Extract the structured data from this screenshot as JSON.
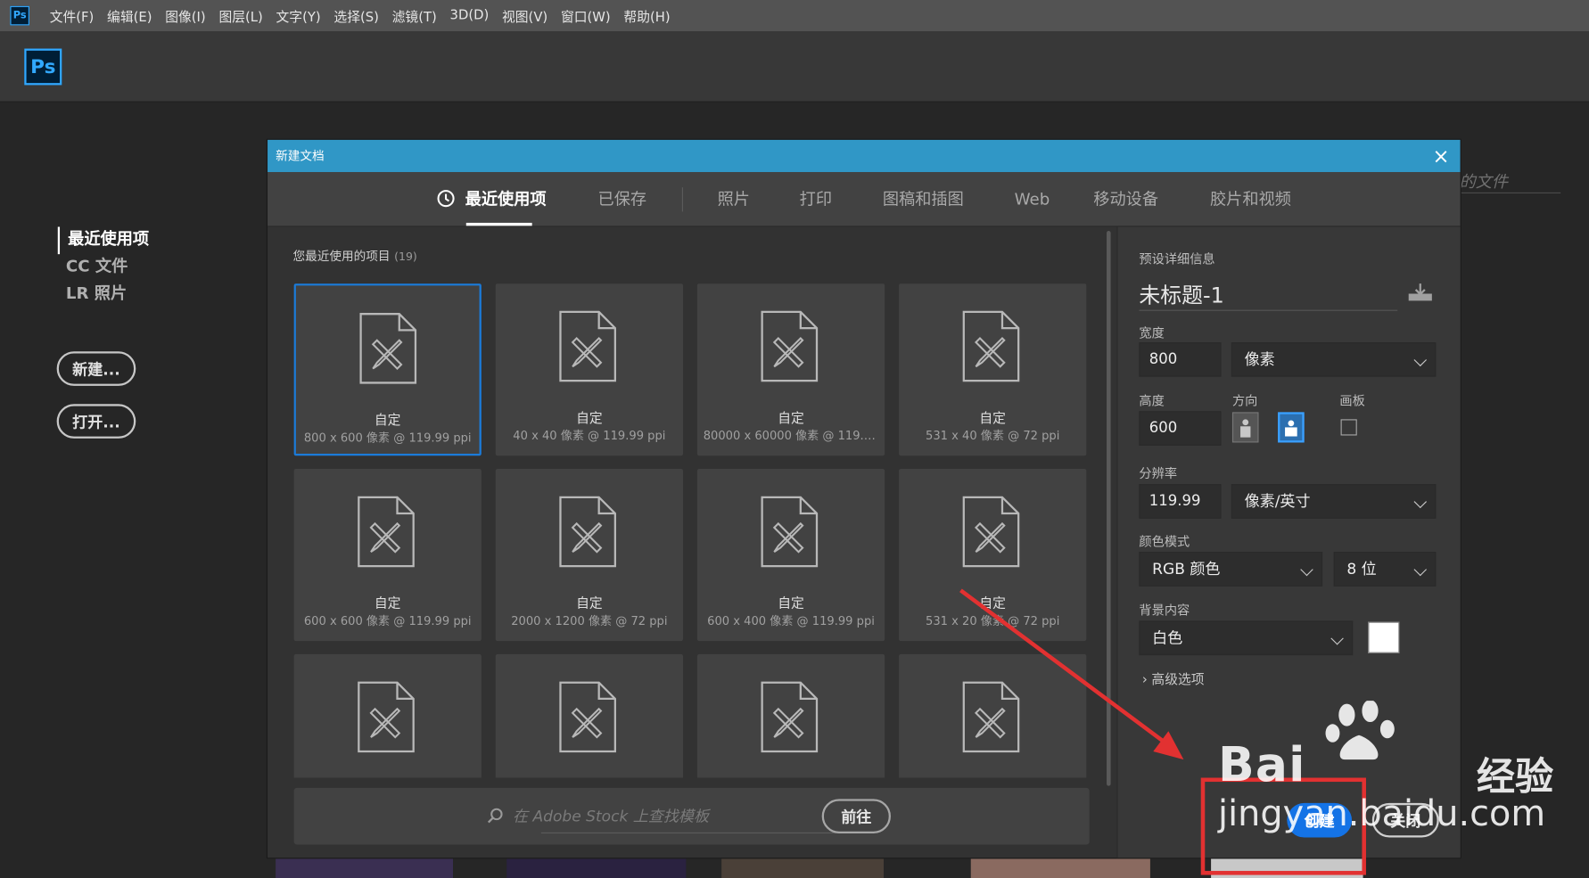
{
  "menubar": {
    "app_icon": "Ps",
    "items": [
      "文件(F)",
      "编辑(E)",
      "图像(I)",
      "图层(L)",
      "文字(Y)",
      "选择(S)",
      "滤镜(T)",
      "3D(D)",
      "视图(V)",
      "窗口(W)",
      "帮助(H)"
    ]
  },
  "appbar": {
    "logo": "Ps"
  },
  "home": {
    "nav": [
      "最近使用项",
      "CC 文件",
      "LR 照片"
    ],
    "new_button": "新建...",
    "open_button": "打开...",
    "recent_files_hint": "的文件"
  },
  "dialog": {
    "title": "新建文档",
    "tabs": [
      "最近使用项",
      "已保存",
      "照片",
      "打印",
      "图稿和插图",
      "Web",
      "移动设备",
      "胶片和视频"
    ],
    "recent_heading": "您最近使用的项目",
    "recent_count": "(19)",
    "presets": [
      {
        "name": "自定",
        "desc": "800 x 600 像素 @ 119.99 ppi"
      },
      {
        "name": "自定",
        "desc": "40 x 40 像素 @ 119.99 ppi"
      },
      {
        "name": "自定",
        "desc": "80000 x 60000 像素 @ 119.9..."
      },
      {
        "name": "自定",
        "desc": "531 x 40 像素 @ 72 ppi"
      },
      {
        "name": "自定",
        "desc": "600 x 600 像素 @ 119.99 ppi"
      },
      {
        "name": "自定",
        "desc": "2000 x 1200 像素 @ 72 ppi"
      },
      {
        "name": "自定",
        "desc": "600 x 400 像素 @ 119.99 ppi"
      },
      {
        "name": "自定",
        "desc": "531 x 20 像素 @ 72 ppi"
      },
      {
        "name": "",
        "desc": ""
      },
      {
        "name": "",
        "desc": ""
      },
      {
        "name": "",
        "desc": ""
      },
      {
        "name": "",
        "desc": ""
      }
    ],
    "stock": {
      "placeholder": "在 Adobe Stock 上查找模板",
      "go_button": "前往"
    },
    "details": {
      "section_label": "预设详细信息",
      "doc_name": "未标题-1",
      "width_label": "宽度",
      "width_value": "800",
      "width_unit": "像素",
      "height_label": "高度",
      "height_value": "600",
      "orientation_label": "方向",
      "artboard_label": "画板",
      "resolution_label": "分辨率",
      "resolution_value": "119.99",
      "resolution_unit": "像素/英寸",
      "color_mode_label": "颜色模式",
      "color_mode_value": "RGB 颜色",
      "bit_depth_value": "8 位",
      "background_label": "背景内容",
      "background_value": "白色",
      "background_swatch": "#ffffff",
      "advanced_label": "高级选项",
      "create_button": "创建",
      "close_button": "关闭"
    }
  },
  "watermark": {
    "brand": "Bai",
    "brand_suffix": "经验",
    "url": "jingyan.baidu.com"
  },
  "colors": {
    "accent": "#1473e6",
    "titlebar": "#3097c6",
    "annotation": "#e23131"
  }
}
